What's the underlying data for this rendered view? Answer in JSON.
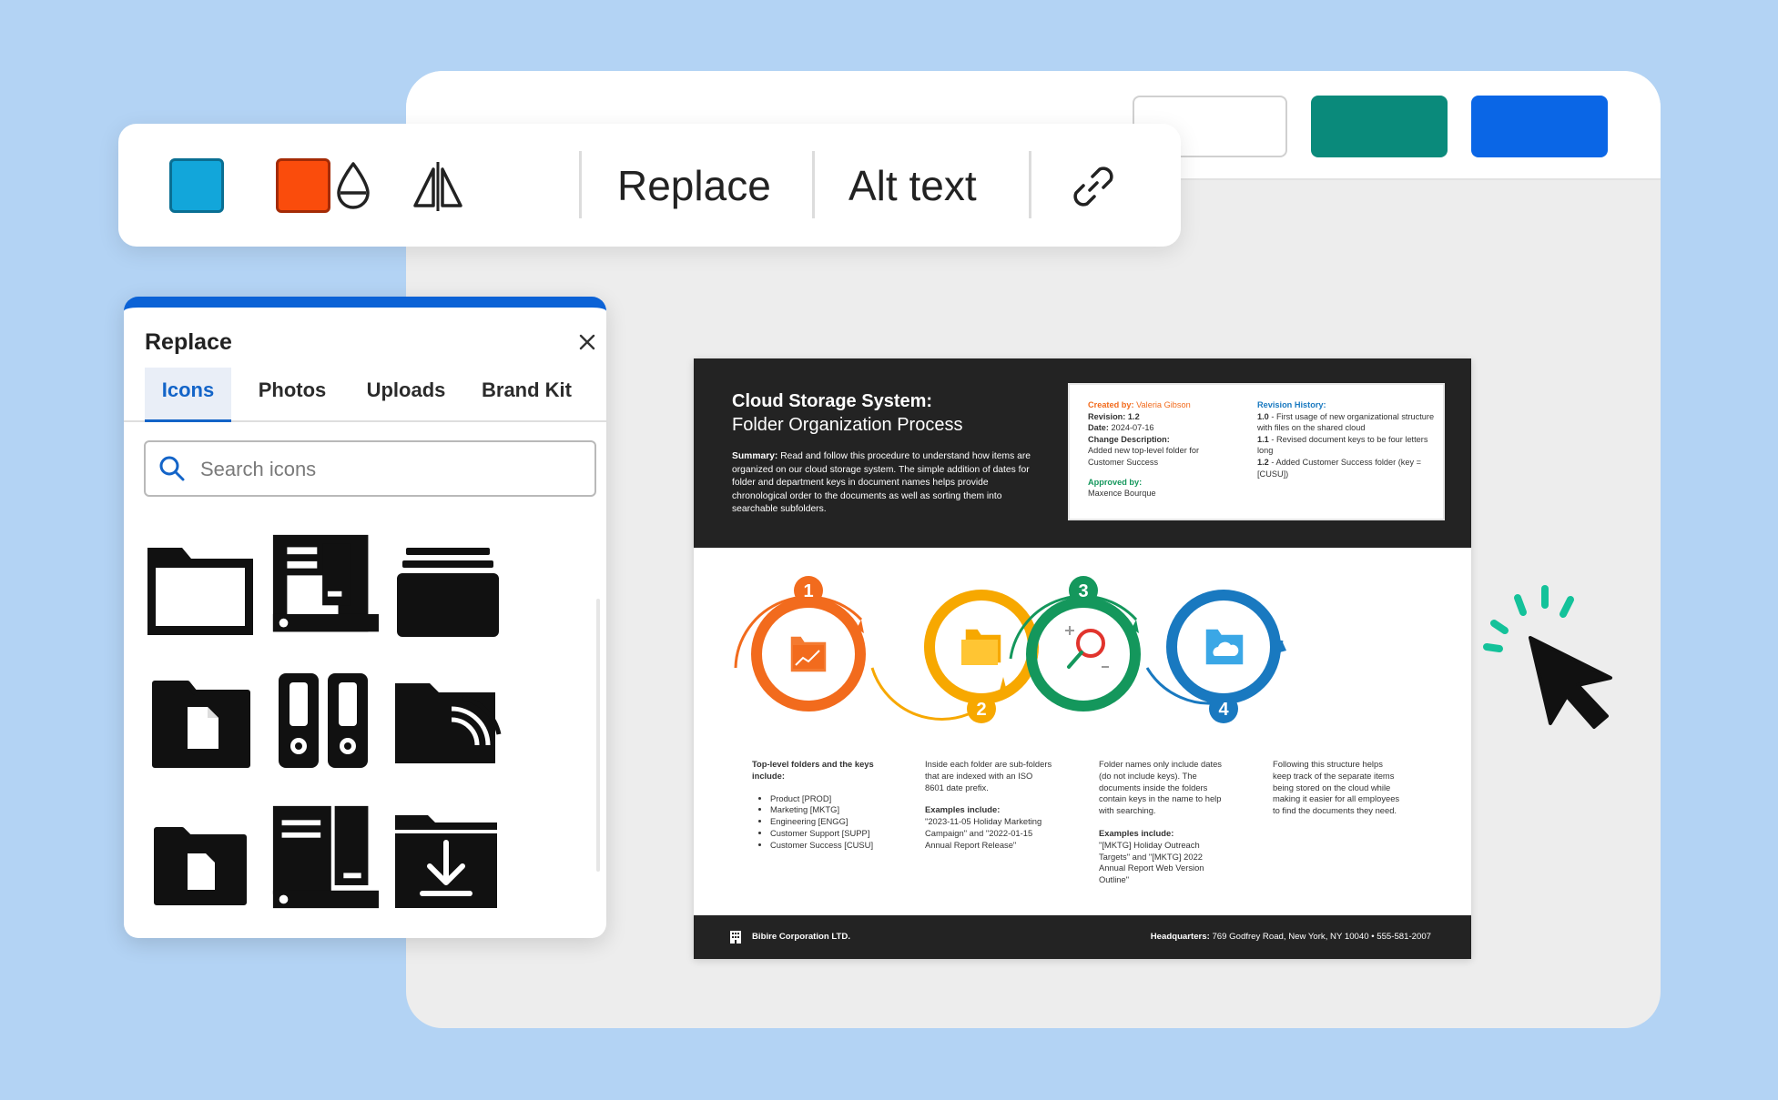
{
  "toolbar": {
    "replace_label": "Replace",
    "alt_text_label": "Alt text",
    "swatches": [
      "#12a6da",
      "#fa4c0c"
    ],
    "icons": [
      "color-swatch-blue",
      "color-swatch-orange",
      "transparency-drop-icon",
      "flip-icon",
      "link-icon"
    ]
  },
  "replace_panel": {
    "title": "Replace",
    "tabs": [
      {
        "label": "Icons"
      },
      {
        "label": "Photos"
      },
      {
        "label": "Uploads"
      },
      {
        "label": "Brand Kit"
      }
    ],
    "search_placeholder": "Search icons",
    "accent": "#0b62d6",
    "grid_icons": [
      "folder-outline-icon",
      "file-cabinet-icon",
      "stacked-folders-icon",
      "folder-document-icon",
      "binders-icon",
      "folder-network-icon",
      "folder-file-icon",
      "server-cabinet-icon",
      "folder-download-icon"
    ]
  },
  "document": {
    "title": "Cloud Storage System:",
    "subtitle": "Folder Organization Process",
    "summary_label": "Summary:",
    "summary_text": "Read and follow this procedure to understand how items are organized on our cloud storage system. The simple addition of dates for folder and department keys in document names helps provide chronological order to the documents as well as sorting them into searchable subfolders.",
    "info": {
      "created_by_label": "Created by:",
      "created_by": "Valeria Gibson",
      "revision_label": "Revision:",
      "revision": "1.2",
      "date_label": "Date:",
      "date": "2024-07-16",
      "change_label": "Change Description:",
      "change": "Added new top-level folder for Customer Success",
      "approved_label": "Approved by:",
      "approved_by": "Maxence Bourque",
      "history_label": "Revision History:",
      "history": [
        {
          "ver": "1.0",
          "text": " - First usage of new organizational structure with files on the shared cloud"
        },
        {
          "ver": "1.1",
          "text": " - Revised document keys to be four letters long"
        },
        {
          "ver": "1.2",
          "text": " - Added Customer Success folder (key = [CUSU])"
        }
      ]
    },
    "steps": [
      {
        "num": "1",
        "color": "#f26b1d"
      },
      {
        "num": "2",
        "color": "#f7a800"
      },
      {
        "num": "3",
        "color": "#14975c"
      },
      {
        "num": "4",
        "color": "#1979c0"
      }
    ],
    "step1": {
      "heading": "Top-level folders and the keys include:",
      "items": [
        "Product [PROD]",
        "Marketing [MKTG]",
        "Engineering [ENGG]",
        "Customer Support [SUPP]",
        "Customer Success [CUSU]"
      ]
    },
    "step2": {
      "text": "Inside each folder are sub-folders that are indexed with an ISO 8601 date prefix.",
      "examples_label": "Examples include:",
      "examples": "\"2023-11-05 Holiday Marketing Campaign\" and \"2022-01-15 Annual Report Release\""
    },
    "step3": {
      "text": "Folder names only include dates (do not include keys). The documents inside the folders contain keys in the name to help with searching.",
      "examples_label": "Examples include:",
      "examples": "\"[MKTG] Holiday Outreach Targets\" and \"[MKTG] 2022 Annual Report Web Version Outline\""
    },
    "step4": {
      "text": "Following this structure helps keep track of the separate items being stored on the cloud while making it easier for all employees to find the documents they need."
    },
    "footer": {
      "company": "Bibire Corporation LTD.",
      "hq_label": "Headquarters:",
      "hq": "769 Godfrey Road, New York, NY 10040 • 555-581-2007"
    }
  },
  "editor_buttons": {
    "teal": "#0a8a7b",
    "blue": "#0a66e6"
  }
}
